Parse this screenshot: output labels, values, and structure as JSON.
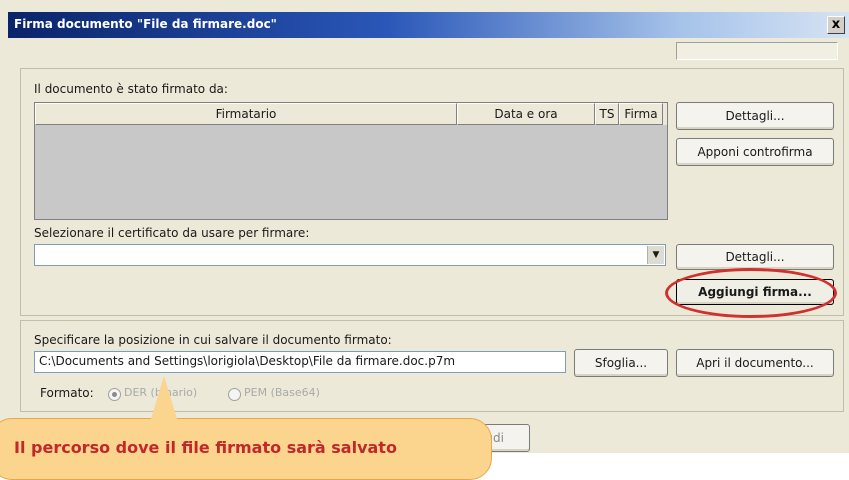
{
  "window": {
    "title": "Firma documento \"File da firmare.doc\"",
    "close_glyph": "x"
  },
  "signed": {
    "label": "Il documento è stato firmato da:",
    "columns": [
      "Firmatario",
      "Data e ora",
      "TS",
      "Firma"
    ],
    "details_button": "Dettagli...",
    "countersign_button": "Apponi controfirma"
  },
  "certificate": {
    "label": "Selezionare il certificato da usare per firmare:",
    "selected_value": "",
    "details_button": "Dettagli...",
    "add_signature_button": "Aggiungi firma..."
  },
  "save": {
    "label": "Specificare la posizione in cui salvare il documento firmato:",
    "path_value": "C:\\Documents and Settings\\lorigiola\\Desktop\\File da firmare.doc.p7m",
    "browse_button": "Sfoglia...",
    "open_button": "Apri il documento...",
    "format_label": "Formato:",
    "format_options": [
      "DER (binario)",
      "PEM (Base64)"
    ],
    "selected_format": "DER (binario)",
    "bottom_button": "Chiudi"
  },
  "callout": {
    "text": "Il percorso dove il file firmato sarà salvato"
  },
  "colors": {
    "title_gradient_start": "#0a246a",
    "dialog_bg": "#ece9d8",
    "list_bg": "#c8c8c8",
    "highlight_ellipse": "#d03030",
    "callout_bg": "#fbd48e",
    "callout_text": "#c0282a"
  }
}
